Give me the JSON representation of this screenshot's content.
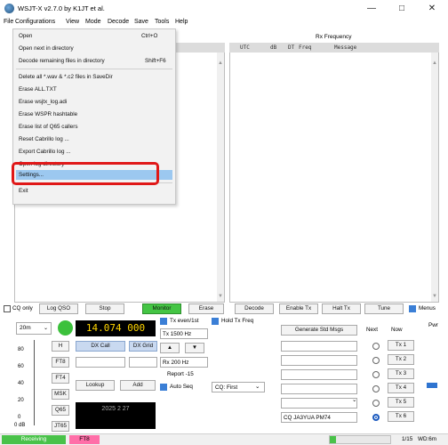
{
  "window": {
    "title": "WSJT-X   v2.7.0   by K1JT et al.",
    "min_icon": "minimize-icon",
    "max_icon": "maximize-icon",
    "close_icon": "close-icon"
  },
  "menubar": [
    "File",
    "Configurations",
    "View",
    "Mode",
    "Decode",
    "Save",
    "Tools",
    "Help"
  ],
  "file_menu": {
    "items": [
      {
        "label": "Open",
        "shortcut": "Ctrl+O"
      },
      {
        "label": "Open next in directory",
        "shortcut": ""
      },
      {
        "label": "Decode remaining files in directory",
        "shortcut": "Shift+F6"
      },
      {
        "label": "Delete all *.wav & *.c2 files in SaveDir",
        "shortcut": ""
      },
      {
        "label": "Erase ALL.TXT",
        "shortcut": ""
      },
      {
        "label": "Erase wsjtx_log.adi",
        "shortcut": ""
      },
      {
        "label": "Erase WSPR hashtable",
        "shortcut": ""
      },
      {
        "label": "Erase list of Q65 callers",
        "shortcut": ""
      },
      {
        "label": "Reset Cabrillo log ...",
        "shortcut": ""
      },
      {
        "label": "Export Cabrillo log ...",
        "shortcut": ""
      },
      {
        "label": "Open log directory",
        "shortcut": ""
      },
      {
        "label": "Settings...",
        "shortcut": ""
      },
      {
        "label": "Exit",
        "shortcut": ""
      }
    ]
  },
  "rx_panel": {
    "title": "Rx Frequency",
    "headers": [
      "UTC",
      "dB",
      "DT",
      "Freq",
      "Message"
    ]
  },
  "controls": {
    "cq_only": "CQ only",
    "log_qso": "Log QSO",
    "stop": "Stop",
    "monitor": "Monitor",
    "erase": "Erase",
    "decode": "Decode",
    "enable_tx": "Enable Tx",
    "halt_tx": "Halt Tx",
    "tune": "Tune",
    "menus": "Menus"
  },
  "station": {
    "band": "20m",
    "frequency": "14.074 000",
    "tx_even": "Tx even/1st",
    "hold_tx_freq": "Hold Tx Freq",
    "tx_freq": "Tx  1500  Hz",
    "rx_freq": "Rx  200  Hz",
    "report": "Report -15",
    "auto_seq": "Auto Seq",
    "cq_first": "CQ: First",
    "dx_call": "DX Call",
    "dx_grid": "DX Grid",
    "lookup": "Lookup",
    "add": "Add",
    "h_button": "H",
    "modes": [
      "FT8",
      "FT4",
      "MSK",
      "Q65",
      "JT65"
    ],
    "meter_ticks": [
      "80",
      "60",
      "40",
      "20",
      "0"
    ],
    "meter_unit": "0 dB",
    "datetime": "2025 2 27"
  },
  "tx_messages": {
    "generate": "Generate Std Msgs",
    "next": "Next",
    "now": "Now",
    "pwr": "Pwr",
    "buttons": [
      "Tx 1",
      "Tx 2",
      "Tx 3",
      "Tx 4",
      "Tx 5",
      "Tx 6"
    ],
    "tx6_message": "CQ JA3YUA PM74"
  },
  "status": {
    "receiving": "Receiving",
    "mode": "FT8",
    "progress_fraction": 0.1,
    "counter": "1/15",
    "wd": "WD:6m"
  }
}
